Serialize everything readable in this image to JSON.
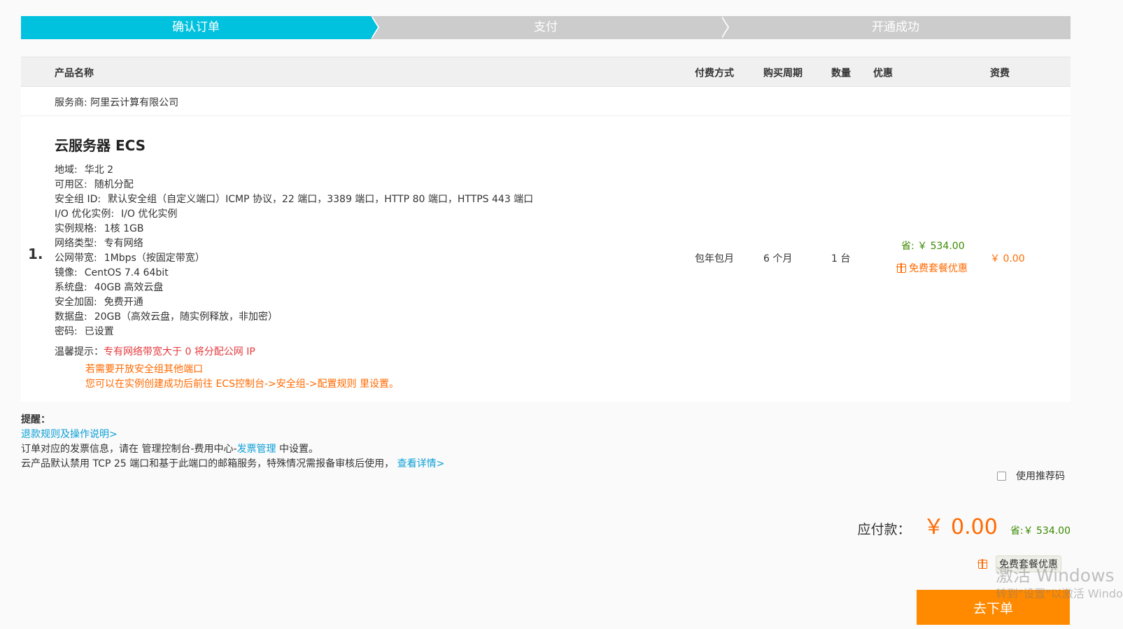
{
  "steps": [
    {
      "label": "确认订单",
      "active": true
    },
    {
      "label": "支付",
      "active": false
    },
    {
      "label": "开通成功",
      "active": false
    }
  ],
  "table": {
    "headers": {
      "product": "产品名称",
      "payment": "付费方式",
      "period": "购买周期",
      "quantity": "数量",
      "discount": "优惠",
      "fee": "资费"
    },
    "provider": "服务商: 阿里云计算有限公司",
    "product": {
      "index": "1.",
      "title": "云服务器 ECS",
      "specs": [
        {
          "k": "地域:",
          "v": "华北 2"
        },
        {
          "k": "可用区:",
          "v": "随机分配"
        },
        {
          "k": "安全组 ID:",
          "v": "默认安全组（自定义端口）ICMP 协议，22 端口，3389 端口，HTTP 80 端口，HTTPS 443 端口"
        },
        {
          "k": "I/O 优化实例:",
          "v": "I/O 优化实例"
        },
        {
          "k": "实例规格:",
          "v": "1核 1GB"
        },
        {
          "k": "网络类型:",
          "v": "专有网络"
        },
        {
          "k": "公网带宽:",
          "v": "1Mbps（按固定带宽）"
        },
        {
          "k": "镜像:",
          "v": "CentOS 7.4 64bit"
        },
        {
          "k": "系统盘:",
          "v": "40GB 高效云盘"
        },
        {
          "k": "安全加固:",
          "v": "免费开通"
        },
        {
          "k": "数据盘:",
          "v": "20GB（高效云盘，随实例释放，非加密）"
        },
        {
          "k": "密码:",
          "v": "已设置"
        }
      ],
      "tip_label": "温馨提示：",
      "tip_red": "专有网络带宽大于 0 将分配公网 IP",
      "tip_line1": "若需要开放安全组其他端口",
      "tip_line2": "您可以在实例创建成功后前往 ECS控制台->安全组->配置规则 里设置。",
      "payment": "包年包月",
      "period": "6 个月",
      "quantity": "1 台",
      "save": "省: ￥ 534.00",
      "gift": "免费套餐优惠",
      "price": "￥ 0.00"
    }
  },
  "notes": {
    "title": "提醒：",
    "refund_link": "退款规则及操作说明>",
    "invoice_prefix": "订单对应的发票信息，请在 管理控制台-费用中心-",
    "invoice_link": "发票管理",
    "invoice_suffix": " 中设置。",
    "tcp_text": "云产品默认禁用 TCP 25 端口和基于此端口的邮箱服务，特殊情况需报备审核后使用，",
    "tcp_link": "查看详情>"
  },
  "referral": {
    "label": "使用推荐码"
  },
  "total": {
    "label": "应付款：",
    "amount": "￥ 0.00",
    "save": "省:￥ 534.00",
    "gift": "免费套餐优惠"
  },
  "submit": {
    "label": "去下单"
  },
  "watermark": {
    "big": "激活 Windows",
    "small": "转到\"设置\"以激活 Windows。"
  },
  "colors": {
    "step_active": "#00c1de",
    "step_inactive": "#cccccc",
    "accent_orange": "#ff6a00",
    "link_blue": "#0b9fd6",
    "save_green": "#3a8a00",
    "button": "#ff8a00"
  }
}
